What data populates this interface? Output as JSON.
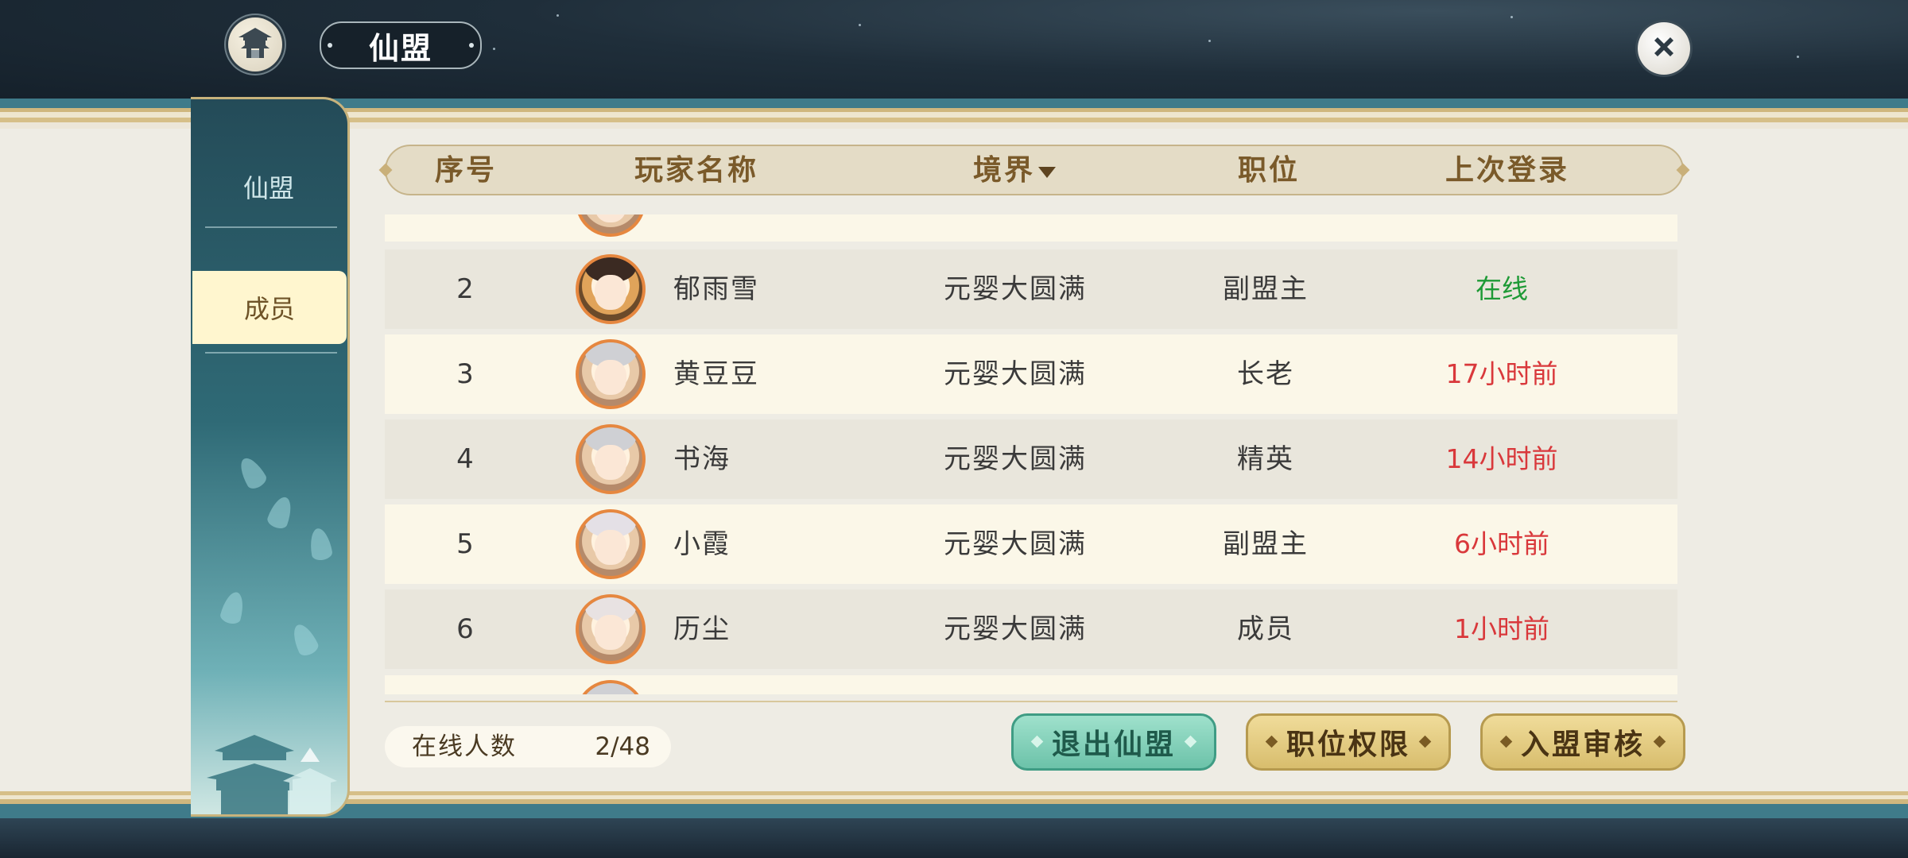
{
  "header": {
    "title": "仙盟"
  },
  "sidebar": {
    "tabs": [
      {
        "label": "仙盟",
        "active": false
      },
      {
        "label": "成员",
        "active": true
      }
    ]
  },
  "table": {
    "columns": [
      "序号",
      "玩家名称",
      "境界",
      "职位",
      "上次登录"
    ],
    "rows": [
      {
        "index": "2",
        "name": "郁雨雪",
        "realm": "元婴大圆满",
        "position": "副盟主",
        "last_login": "在线",
        "status": "online"
      },
      {
        "index": "3",
        "name": "黄豆豆",
        "realm": "元婴大圆满",
        "position": "长老",
        "last_login": "17小时前",
        "status": "offline"
      },
      {
        "index": "4",
        "name": "书海",
        "realm": "元婴大圆满",
        "position": "精英",
        "last_login": "14小时前",
        "status": "offline"
      },
      {
        "index": "5",
        "name": "小霞",
        "realm": "元婴大圆满",
        "position": "副盟主",
        "last_login": "6小时前",
        "status": "offline"
      },
      {
        "index": "6",
        "name": "历尘",
        "realm": "元婴大圆满",
        "position": "成员",
        "last_login": "1小时前",
        "status": "offline"
      }
    ]
  },
  "footer": {
    "online_label": "在线人数",
    "online_value": "2/48",
    "buttons": {
      "leave": "退出仙盟",
      "permissions": "职位权限",
      "review": "入盟审核"
    }
  },
  "colors": {
    "online": "#1e9a36",
    "offline": "#d9383b",
    "header_text": "#7a5a2a",
    "teal_button": "#6cc2a9",
    "gold_button": "#d8bd6d"
  }
}
